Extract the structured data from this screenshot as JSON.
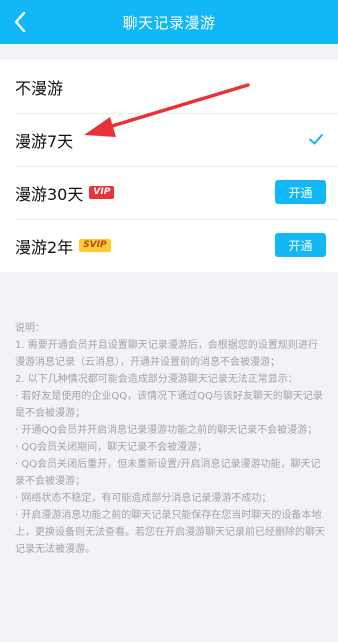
{
  "header": {
    "title": "聊天记录漫游"
  },
  "options": [
    {
      "label": "不漫游"
    },
    {
      "label": "漫游7天",
      "selected": true
    },
    {
      "label": "漫游30天",
      "badge": "VIP",
      "button": "开通"
    },
    {
      "label": "漫游2年",
      "badge": "SVIP",
      "button": "开通"
    }
  ],
  "colors": {
    "accent": "#12b7f5",
    "arrow": "#e8323a",
    "vip": "#e8333b",
    "svip": "#ffcc33"
  },
  "description": {
    "lines": [
      "说明：",
      "1. 需要开通会员并且设置聊天记录漫游后，会根据您的设置规则进行漫游消息记录（云消息），开通并设置前的消息不会被漫游；",
      "2. 以下几种情况都可能会造成部分漫游聊天记录无法正常显示：",
      "· 若好友是使用的企业QQ，该情况下通过QQ与该好友聊天的聊天记录是不会被漫游；",
      "· 开通QQ会员并开启消息记录漫游功能之前的聊天记录不会被漫游；",
      "· QQ会员关闭期间，聊天记录不会被漫游；",
      "· QQ会员关闭后重开，但未重新设置/开启消息记录漫游功能，聊天记录不会被漫游；",
      "· 网络状态不稳定，有可能造成部分消息记录漫游不成功；",
      "· 开启漫游消息功能之前的聊天记录只能保存在您当时聊天的设备本地上，更换设备则无法查看。若您在开启漫游聊天记录前已经删除的聊天记录无法被漫游。"
    ]
  }
}
